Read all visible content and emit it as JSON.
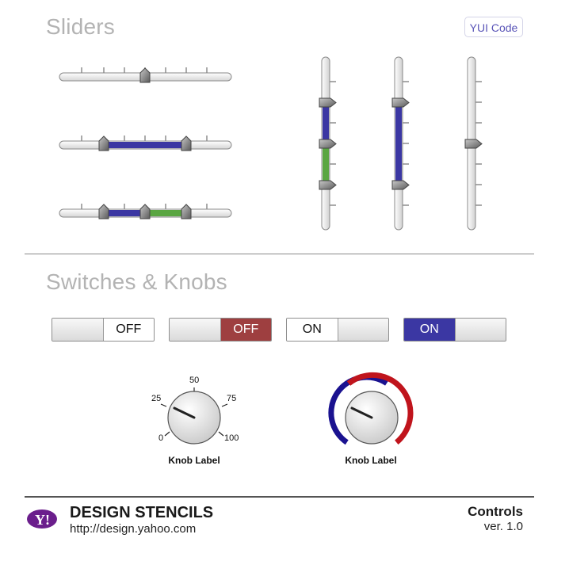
{
  "sliders": {
    "title": "Sliders",
    "code_button": "YUI Code"
  },
  "switches": {
    "title": "Switches & Knobs",
    "items": [
      {
        "label": "OFF",
        "state": "off"
      },
      {
        "label": "OFF",
        "state": "off-red"
      },
      {
        "label": "ON",
        "state": "on"
      },
      {
        "label": "ON",
        "state": "on-blue"
      }
    ]
  },
  "knobs": [
    {
      "label": "Knob Label",
      "ticks": [
        "0",
        "25",
        "50",
        "75",
        "100"
      ]
    },
    {
      "label": "Knob Label"
    }
  ],
  "footer": {
    "logo_text": "Y!",
    "brand": "DESIGN STENCILS",
    "url": "http://design.yahoo.com",
    "doc_title": "Controls",
    "version": "ver. 1.0"
  },
  "colors": {
    "title_gray": "#b3b3b3",
    "range_blue": "#3b37a3",
    "range_green": "#5aa642",
    "switch_red": "#9e3f40",
    "knob_blue": "#1a1290",
    "knob_red": "#c0141c",
    "yahoo_purple": "#6b1e8c"
  }
}
